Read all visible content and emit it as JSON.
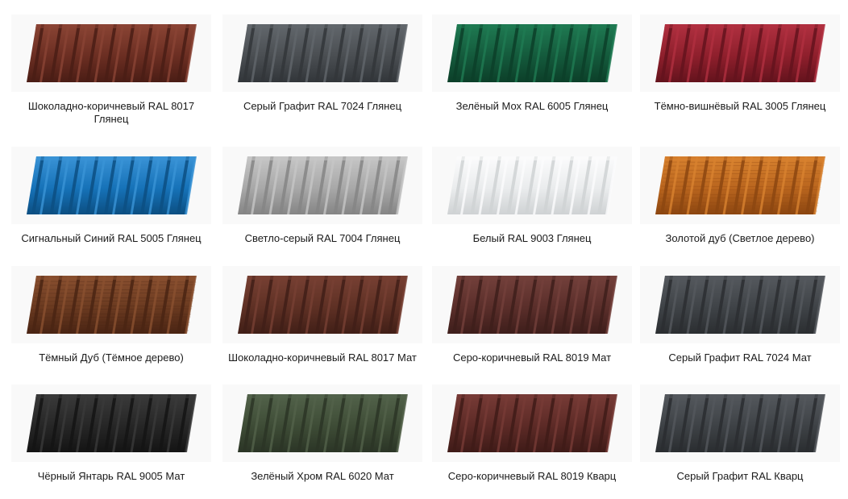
{
  "products": [
    {
      "label": "Шоколадно-коричневый RAL 8017 Глянец",
      "color": "#6b2e22",
      "highlight": "#8a4434",
      "shade": "#4a1d15",
      "texture": "none"
    },
    {
      "label": "Серый Графит RAL 7024 Глянец",
      "color": "#4a4e52",
      "highlight": "#62676c",
      "shade": "#32363a",
      "texture": "none"
    },
    {
      "label": "Зелёный Мох RAL 6005 Глянец",
      "color": "#145a3c",
      "highlight": "#1f7a52",
      "shade": "#0c3f29",
      "texture": "none"
    },
    {
      "label": "Тёмно-вишнёвый RAL 3005 Глянец",
      "color": "#8e1f2c",
      "highlight": "#b03040",
      "shade": "#64131d",
      "texture": "none"
    },
    {
      "label": "Сигнальный Синий RAL 5005 Глянец",
      "color": "#1672b8",
      "highlight": "#3a93d6",
      "shade": "#0c4f82",
      "texture": "none"
    },
    {
      "label": "Светло-серый RAL 7004 Глянец",
      "color": "#a8a8a8",
      "highlight": "#c6c6c6",
      "shade": "#858585",
      "texture": "none"
    },
    {
      "label": "Белый RAL 9003 Глянец",
      "color": "#eaeced",
      "highlight": "#fbfbfc",
      "shade": "#cfd2d4",
      "texture": "none"
    },
    {
      "label": "Золотой дуб (Светлое дерево)",
      "color": "#b9651e",
      "highlight": "#d8822f",
      "shade": "#8c4610",
      "texture": "wood"
    },
    {
      "label": "Тёмный Дуб (Тёмное дерево)",
      "color": "#6a3a20",
      "highlight": "#8a5030",
      "shade": "#4a2413",
      "texture": "wood"
    },
    {
      "label": "Шоколадно-коричневый RAL 8017 Мат",
      "color": "#5e3024",
      "highlight": "#774033",
      "shade": "#411f17",
      "texture": "none"
    },
    {
      "label": "Серо-коричневый RAL 8019 Мат",
      "color": "#5a2e2a",
      "highlight": "#73403b",
      "shade": "#3e1e1b",
      "texture": "none"
    },
    {
      "label": "Серый Графит RAL 7024 Мат",
      "color": "#3f4347",
      "highlight": "#55595e",
      "shade": "#2b2e31",
      "texture": "none"
    },
    {
      "label": "Чёрный Янтарь RAL 9005 Мат",
      "color": "#262626",
      "highlight": "#3a3a3a",
      "shade": "#141414",
      "texture": "none"
    },
    {
      "label": "Зелёный Хром RAL 6020 Мат",
      "color": "#3e4c36",
      "highlight": "#52624a",
      "shade": "#2b3526",
      "texture": "none"
    },
    {
      "label": "Серо-коричневый RAL 8019 Кварц",
      "color": "#5c2a26",
      "highlight": "#773b36",
      "shade": "#3f1b18",
      "texture": "none"
    },
    {
      "label": "Серый Графит RAL Кварц",
      "color": "#3e4246",
      "highlight": "#54585d",
      "shade": "#2a2d30",
      "texture": "none"
    }
  ]
}
